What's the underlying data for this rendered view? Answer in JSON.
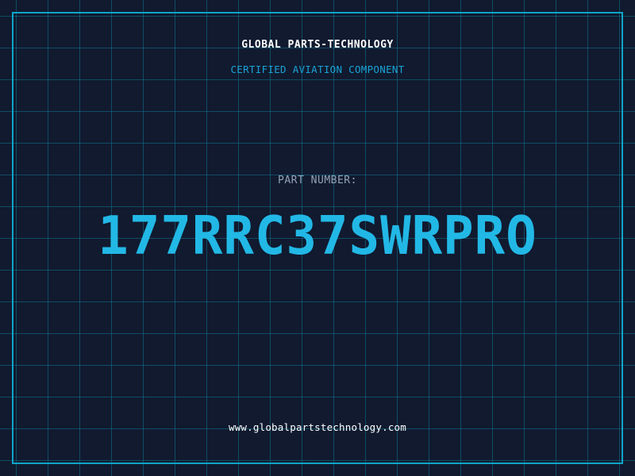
{
  "header": {
    "company_name": "GLOBAL PARTS-TECHNOLOGY",
    "certification": "CERTIFIED AVIATION COMPONENT"
  },
  "part": {
    "label": "PART NUMBER:",
    "number": "177RRC37SWRPRO"
  },
  "footer": {
    "website": "www.globalpartstechnology.com"
  },
  "colors": {
    "background": "#111a2f",
    "grid": "#0e7490",
    "frame": "#0ea5c9",
    "accent": "#22b8e6",
    "label": "#94a3b8",
    "text": "#ffffff"
  }
}
